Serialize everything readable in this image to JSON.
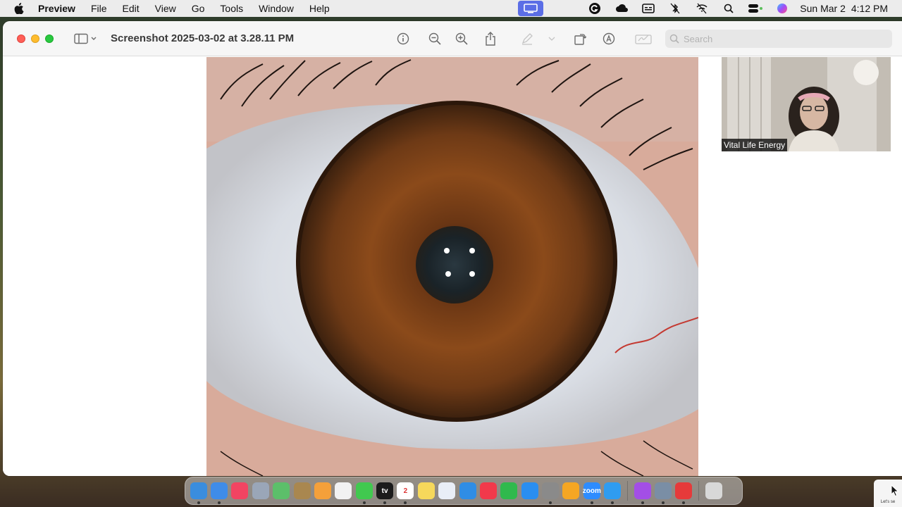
{
  "menubar": {
    "app_name": "Preview",
    "items": [
      "File",
      "Edit",
      "View",
      "Go",
      "Tools",
      "Window",
      "Help"
    ],
    "clock": {
      "day": "Sun Mar 2",
      "time": "4:12 PM"
    }
  },
  "window": {
    "title": "Screenshot 2025-03-02 at 3.28.11 PM",
    "search_placeholder": "Search"
  },
  "video": {
    "participant_name": "Vital Life Energy"
  },
  "dock": {
    "apps": [
      {
        "name": "finder",
        "color": "#3a8dde",
        "label": ""
      },
      {
        "name": "mail",
        "color": "#3f8ce8",
        "label": ""
      },
      {
        "name": "music",
        "color": "#f24462",
        "label": ""
      },
      {
        "name": "launchpad",
        "color": "#9aa6b8",
        "label": ""
      },
      {
        "name": "maps",
        "color": "#5cbf6a",
        "label": ""
      },
      {
        "name": "notes-brown",
        "color": "#a9874f",
        "label": ""
      },
      {
        "name": "photos",
        "color": "#f4a03a",
        "label": ""
      },
      {
        "name": "reminders",
        "color": "#f2f2f2",
        "label": ""
      },
      {
        "name": "messages",
        "color": "#41c94f",
        "label": ""
      },
      {
        "name": "apple-tv",
        "color": "#1b1b1b",
        "label": "tv"
      },
      {
        "name": "calendar",
        "color": "#ffffff",
        "label": "2"
      },
      {
        "name": "notes",
        "color": "#f6d85b",
        "label": ""
      },
      {
        "name": "freeform",
        "color": "#e9eef7",
        "label": ""
      },
      {
        "name": "keynote",
        "color": "#2f8de5",
        "label": ""
      },
      {
        "name": "news",
        "color": "#f2394b",
        "label": ""
      },
      {
        "name": "numbers",
        "color": "#30b94d",
        "label": ""
      },
      {
        "name": "app-store",
        "color": "#2a8ef0",
        "label": ""
      },
      {
        "name": "system-settings",
        "color": "#8a8a8a",
        "label": ""
      },
      {
        "name": "pages",
        "color": "#f5a623",
        "label": ""
      },
      {
        "name": "zoom",
        "color": "#2d8cff",
        "label": "zoom"
      },
      {
        "name": "safari",
        "color": "#2f9cf0",
        "label": ""
      }
    ],
    "recent": [
      {
        "name": "podcasts",
        "color": "#a34ee6"
      },
      {
        "name": "preview",
        "color": "#7a8ea5"
      },
      {
        "name": "acrobat",
        "color": "#e63a3a"
      }
    ],
    "trash": {
      "name": "trash",
      "color": "#d8d8d8"
    }
  },
  "corner": {
    "note": "Let's se"
  }
}
